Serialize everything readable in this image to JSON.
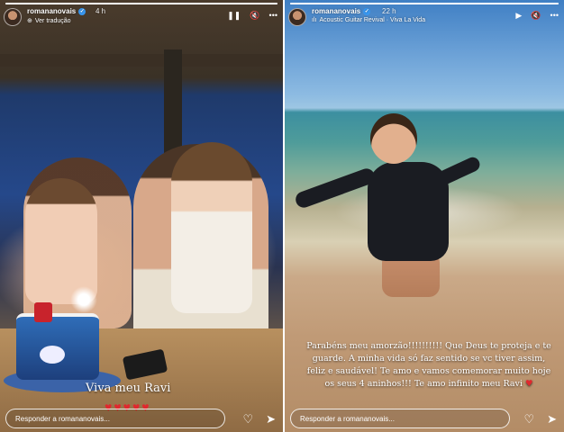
{
  "left_story": {
    "progress": 1.0,
    "username": "romananovais",
    "time": "4 h",
    "translate_link": "Ver tradução",
    "caption": "Viva meu Ravi",
    "hearts": "♥♥♥♥♥",
    "reply_placeholder": "Responder a romananovais...",
    "icons": {
      "pause": "❚❚",
      "mute": "🔇",
      "more": "•••",
      "like": "♡",
      "send": "➤"
    }
  },
  "right_story": {
    "progress": 1.0,
    "username": "romananovais",
    "time": "22 h",
    "music_track": "Acoustic Guitar Revival · Viva La Vida",
    "caption": "Parabéns meu amorzão!!!!!!!!!! Que Deus te proteja e te guarde. A minha vida só faz sentido se vc tiver assim, feliz e saudável! Te amo e vamos comemorar muito hoje os seus 4 aninhos!!! Te amo infinito meu Ravi",
    "caption_heart": "♥",
    "reply_placeholder": "Responder a romananovais...",
    "icons": {
      "play": "▶",
      "mute": "🔇",
      "more": "•••",
      "like": "♡",
      "send": "➤"
    }
  },
  "colors": {
    "verified": "#3897f0",
    "heart": "#e0282e"
  }
}
